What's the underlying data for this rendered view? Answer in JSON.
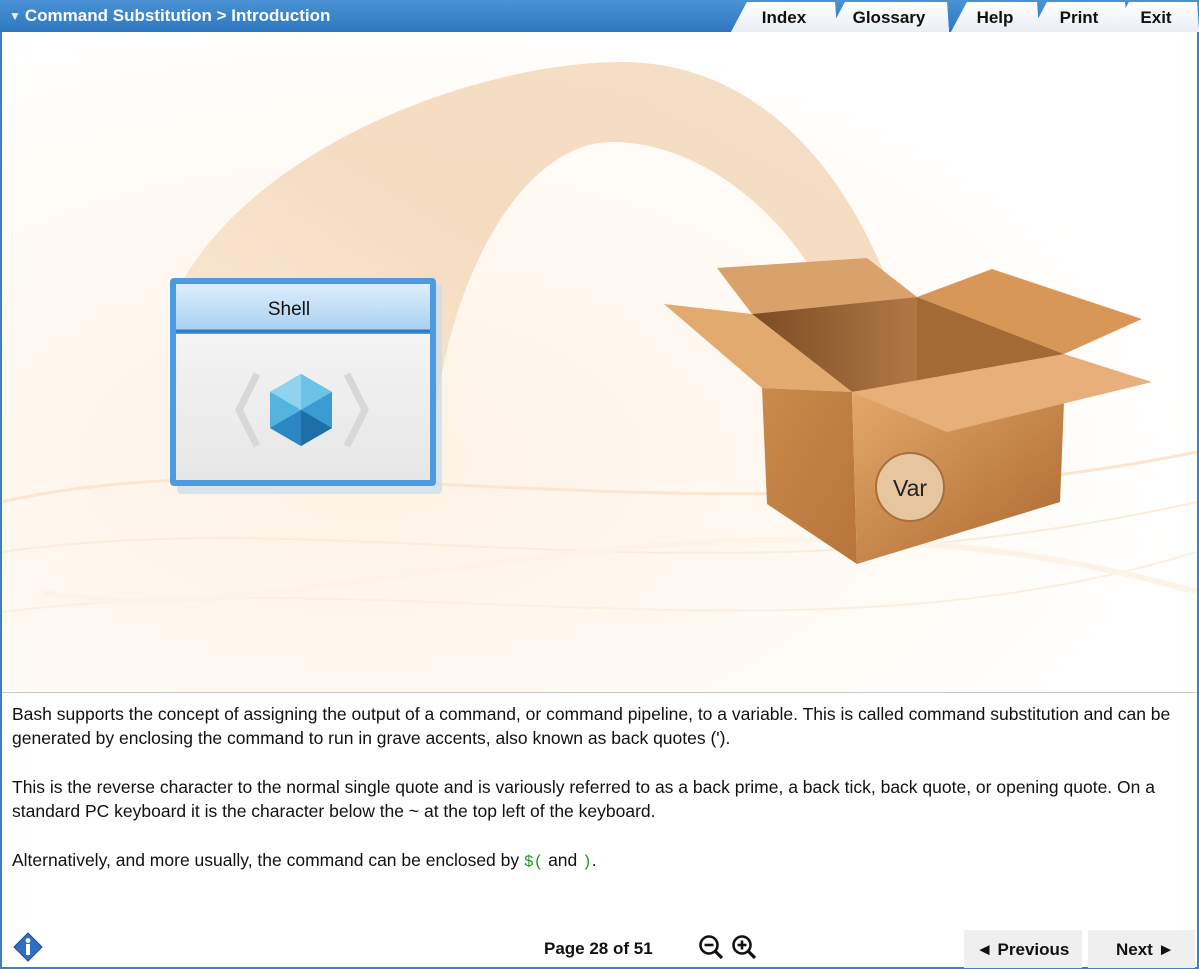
{
  "header": {
    "breadcrumb": "Command Substitution > Introduction",
    "tabs": [
      {
        "label": "Index"
      },
      {
        "label": "Glossary"
      },
      {
        "label": "Help"
      },
      {
        "label": "Print"
      },
      {
        "label": "Exit"
      }
    ]
  },
  "illustration": {
    "shell_label": "Shell",
    "var_label": "Var"
  },
  "body": {
    "p1": "Bash supports the concept of assigning the output of a command, or command pipeline, to a variable. This is called command substitution and can be generated by enclosing the command to run in grave accents, also known as back quotes (').",
    "p2": "This is the reverse character to the normal single quote and is variously referred to as a back prime, a back tick, back quote, or opening quote. On a standard PC keyboard it is the character below the ~ at the top left of the keyboard.",
    "p3_prefix": "Alternatively, and more usually, the command can be enclosed by",
    "code_open": "$(",
    "p3_mid": "and",
    "code_close": ")",
    "p3_suffix": "."
  },
  "footer": {
    "page_label": "Page 28 of 51",
    "previous_label": "◄ Previous",
    "next_label": "Next ►",
    "icons": {
      "info": "info-icon",
      "zoom_out": "zoom-out-icon",
      "zoom_in": "zoom-in-icon"
    }
  },
  "colors": {
    "accent": "#2e78c2",
    "code": "#1a9a1a",
    "box": "#c98a4b"
  }
}
